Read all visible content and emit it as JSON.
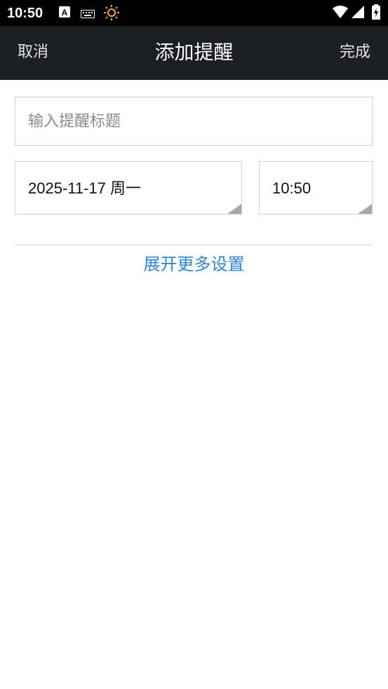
{
  "status_bar": {
    "time": "10:50",
    "icons": [
      "a-notification-icon",
      "keyboard-icon",
      "brightness-icon",
      "wifi-icon",
      "signal-icon",
      "battery-icon"
    ],
    "accent_icon_color": "#f5a623"
  },
  "app_bar": {
    "left_button": "取消",
    "title": "添加提醒",
    "right_button": "完成",
    "background": "#1d1e22"
  },
  "form": {
    "title_placeholder": "输入提醒标题",
    "title_value": "",
    "date": "2025-11-17 周一",
    "time": "10:50"
  },
  "more_settings": {
    "label": "展开更多设置",
    "color": "#2e86d6"
  }
}
